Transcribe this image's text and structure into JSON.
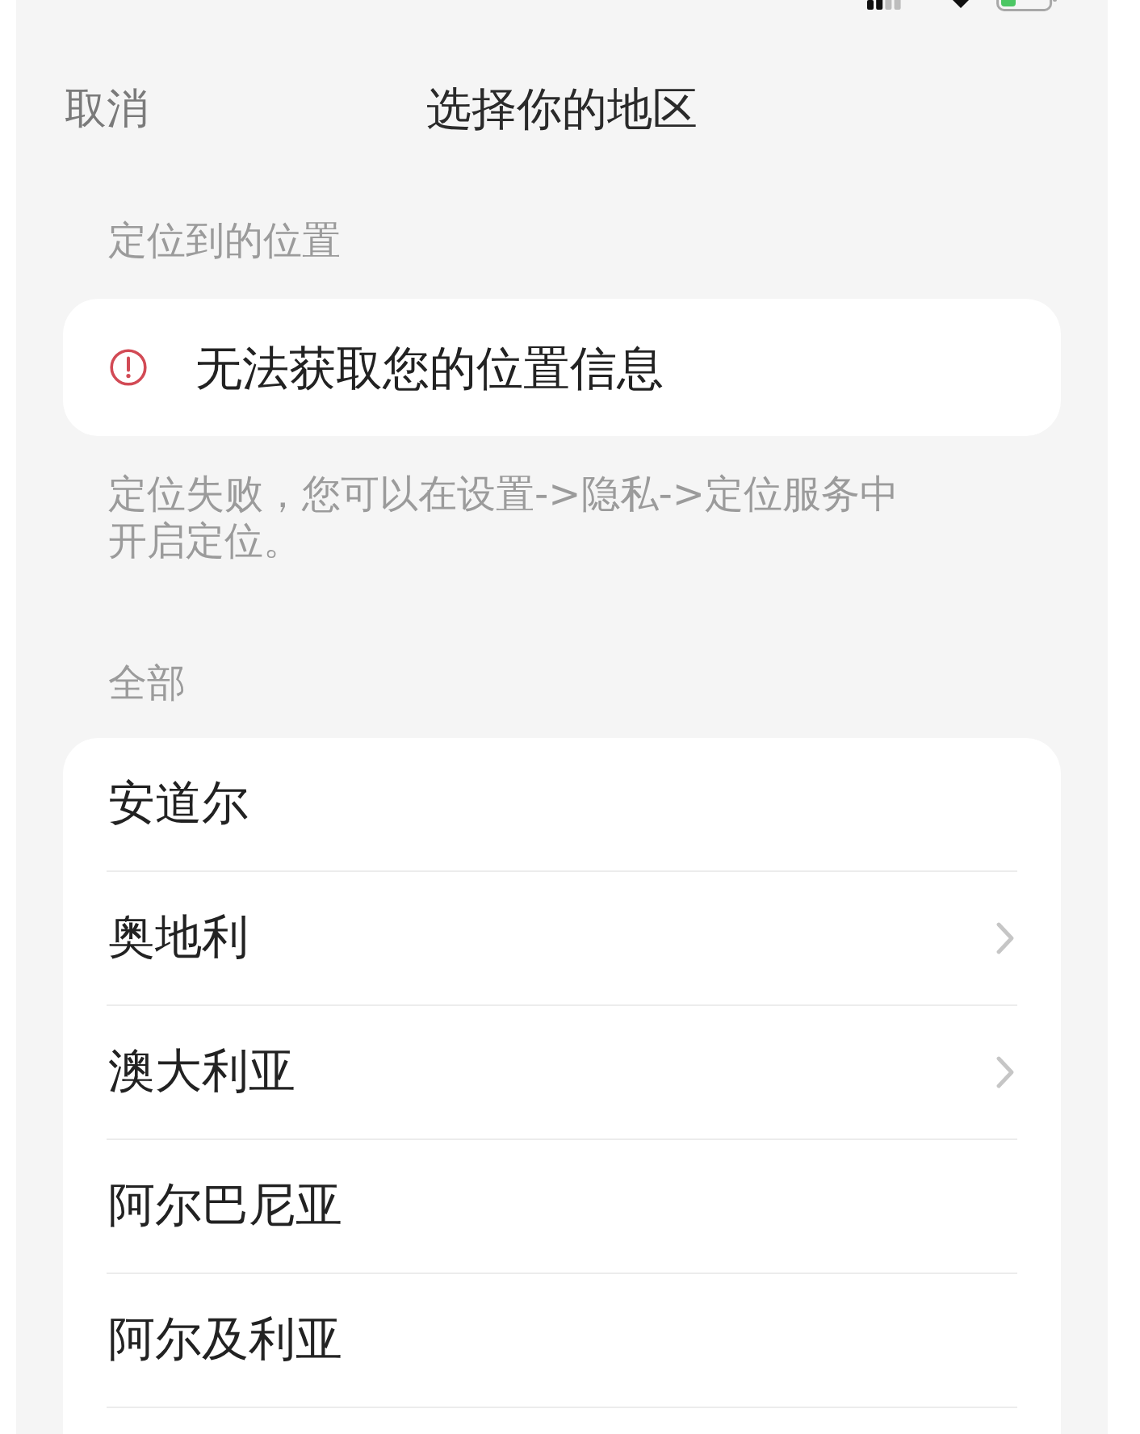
{
  "nav_bar": {
    "cancel": "取消",
    "title": "选择你的地区"
  },
  "location": {
    "label": "定位到的位置",
    "message": "无法获取您的位置信息",
    "hint": "定位失败，您可以在设置->隐私->定位服务中开启定位。"
  },
  "regions": {
    "label": "全部",
    "items": [
      {
        "name": "安道尔",
        "drill_down": false
      },
      {
        "name": "奥地利",
        "drill_down": true
      },
      {
        "name": "澳大利亚",
        "drill_down": true
      },
      {
        "name": "阿尔巴尼亚",
        "drill_down": false
      },
      {
        "name": "阿尔及利亚",
        "drill_down": false
      }
    ]
  }
}
